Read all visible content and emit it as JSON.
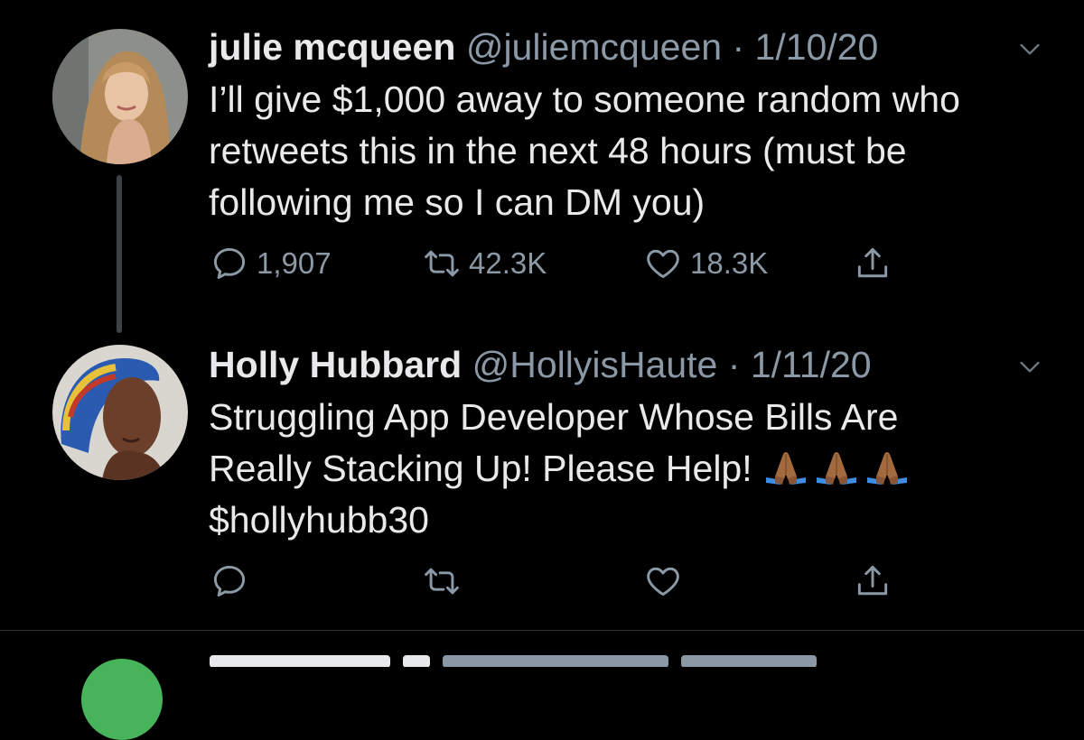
{
  "tweets": [
    {
      "author_name": "julie mcqueen",
      "handle": "@juliemcqueen",
      "separator": "·",
      "date": "1/10/20",
      "text": "I’ll give $1,000 away to someone random who\nretweets this in the next 48 hours (must be\nfollowing me so I can DM you)",
      "reply_count": "1,907",
      "retweet_count": "42.3K",
      "like_count": "18.3K"
    },
    {
      "author_name": "Holly Hubbard",
      "handle": "@HollyisHaute",
      "separator": "·",
      "date": "1/11/20",
      "text_line1": "Struggling App Developer Whose Bills Are",
      "text_line2": "Really Stacking Up! Please Help!",
      "text_line3": "$hollyhubb30",
      "emoji": [
        "🙏🏾",
        "🙏🏾",
        "🙏🏾"
      ],
      "reply_count": "",
      "retweet_count": "",
      "like_count": ""
    }
  ],
  "colors": {
    "background": "#000000",
    "text_primary": "#e7e9ea",
    "text_secondary": "#8b98a5",
    "thread_line": "#3d4247"
  },
  "icons": [
    "reply-icon",
    "retweet-icon",
    "like-icon",
    "share-icon",
    "chevron-down-icon",
    "folded-hands-emoji"
  ]
}
